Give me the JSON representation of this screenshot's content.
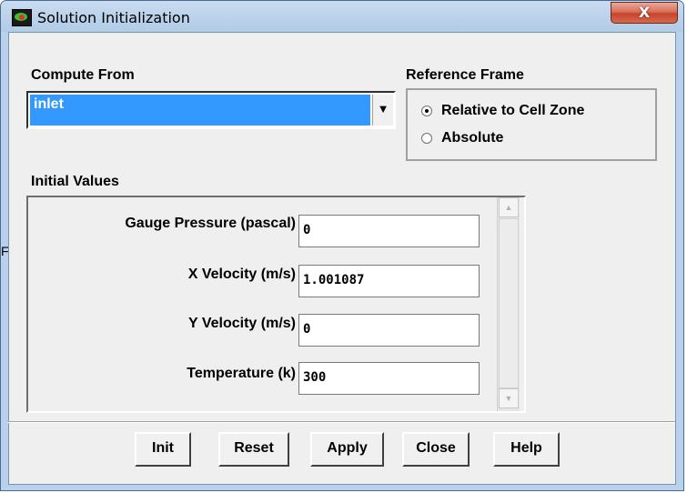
{
  "window": {
    "title": "Solution Initialization",
    "close_glyph": "X"
  },
  "compute_from": {
    "label": "Compute From",
    "selected": "inlet",
    "arrow": "▼"
  },
  "reference_frame": {
    "label": "Reference Frame",
    "options": [
      {
        "label": "Relative to Cell Zone",
        "selected": true
      },
      {
        "label": "Absolute",
        "selected": false
      }
    ]
  },
  "initial_values": {
    "label": "Initial Values",
    "fields": [
      {
        "label": "Gauge Pressure (pascal)",
        "value": "0"
      },
      {
        "label": "X Velocity (m/s)",
        "value": "1.001087"
      },
      {
        "label": "Y Velocity (m/s)",
        "value": "0"
      },
      {
        "label": "Temperature (k)",
        "value": "300"
      }
    ]
  },
  "buttons": {
    "init": "Init",
    "reset": "Reset",
    "apply": "Apply",
    "close": "Close",
    "help": "Help"
  },
  "scrollbar": {
    "up": "▲",
    "down": "▼"
  },
  "stray_char": "F"
}
